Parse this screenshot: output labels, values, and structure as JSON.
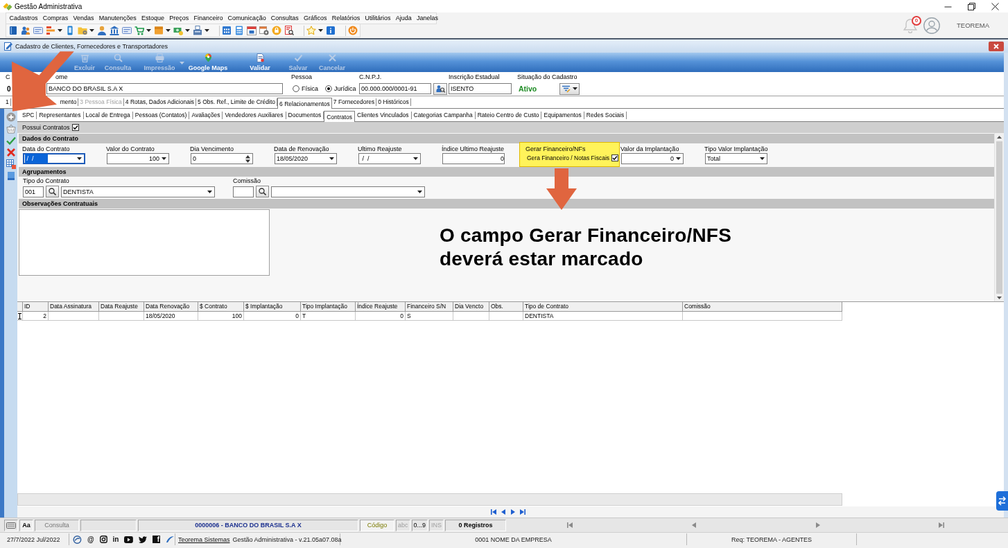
{
  "app": {
    "title": "Gestão Administrativa"
  },
  "menu": [
    "Cadastros",
    "Compras",
    "Vendas",
    "Manutenções",
    "Estoque",
    "Preços",
    "Financeiro",
    "Comunicação",
    "Consultas",
    "Gráficos",
    "Relatórios",
    "Utilitários",
    "Ajuda",
    "Janelas"
  ],
  "toolbar": [
    [
      {
        "kind": "book",
        "dropdown": false
      },
      {
        "kind": "people",
        "dropdown": false
      },
      {
        "kind": "card",
        "dropdown": false
      },
      {
        "kind": "chart",
        "dropdown": true
      },
      {
        "kind": "phone",
        "dropdown": false
      },
      {
        "kind": "folder",
        "dropdown": true
      },
      {
        "kind": "person",
        "dropdown": false
      },
      {
        "kind": "bank",
        "dropdown": false
      },
      {
        "kind": "card",
        "dropdown": false
      },
      {
        "kind": "cart",
        "dropdown": true
      },
      {
        "kind": "package",
        "dropdown": true
      },
      {
        "kind": "money",
        "dropdown": true
      },
      {
        "kind": "register",
        "dropdown": true
      }
    ],
    [
      {
        "kind": "grid-calendar",
        "dropdown": false
      },
      {
        "kind": "calculator",
        "dropdown": false
      },
      {
        "kind": "calendar",
        "dropdown": false
      },
      {
        "kind": "calendar-gear",
        "dropdown": false
      },
      {
        "kind": "lock",
        "dropdown": false
      },
      {
        "kind": "report",
        "dropdown": false
      }
    ],
    [
      {
        "kind": "star",
        "dropdown": true
      },
      {
        "kind": "info",
        "dropdown": false
      }
    ],
    [
      {
        "kind": "power",
        "dropdown": false
      }
    ]
  ],
  "user": {
    "notifications": "0",
    "name": "TEOREMA"
  },
  "form_window": {
    "title": "Cadastro de Clientes, Fornecedores e Transportadores"
  },
  "actions": [
    {
      "kind": "delete",
      "label": "Excluir",
      "disabled": true,
      "dropdown": false
    },
    {
      "kind": "search",
      "label": "Consulta",
      "disabled": true,
      "dropdown": false
    },
    {
      "kind": "print",
      "label": "Impressão",
      "disabled": true,
      "dropdown": true
    },
    {
      "kind": "map",
      "label": "Google Maps",
      "disabled": false,
      "dropdown": false
    },
    {
      "kind": "validate",
      "label": "Validar",
      "disabled": false,
      "dropdown": false
    },
    {
      "kind": "save",
      "label": "Salvar",
      "disabled": true,
      "dropdown": false
    },
    {
      "kind": "cancel",
      "label": "Cancelar",
      "disabled": true,
      "dropdown": false
    }
  ],
  "header": {
    "code": {
      "label": "C",
      "value": "0"
    },
    "name": {
      "label": "ome",
      "value": "BANCO DO BRASIL S.A X"
    },
    "person": {
      "label": "Pessoa",
      "options": [
        {
          "label": "Física",
          "selected": false
        },
        {
          "label": "Jurídica",
          "selected": true
        }
      ]
    },
    "cnpj": {
      "label": "C.N.P.J.",
      "value": "00.000.000/0001-91"
    },
    "state_registration": {
      "label": "Inscrição Estadual",
      "value": "ISENTO"
    },
    "status": {
      "label": "Situação do Cadastro",
      "value": "Ativo"
    }
  },
  "main_tabs": [
    {
      "label": "1",
      "selected": false,
      "disabled": false
    },
    {
      "label": "mento",
      "selected": false,
      "disabled": false
    },
    {
      "label": "3 Pessoa Física",
      "selected": false,
      "disabled": true
    },
    {
      "label": "4 Rotas, Dados Adicionais",
      "selected": false,
      "disabled": false
    },
    {
      "label": "5 Obs. Ref., Limite de Crédito",
      "selected": false,
      "disabled": false
    },
    {
      "label": "6 Relacionamentos",
      "selected": true,
      "disabled": false
    },
    {
      "label": "7 Fornecedores",
      "selected": false,
      "disabled": false
    },
    {
      "label": "0 Históricos",
      "selected": false,
      "disabled": false
    }
  ],
  "side_toolbar": [
    {
      "kind": "add"
    },
    {
      "kind": "basket"
    },
    {
      "kind": "confirm"
    },
    {
      "kind": "discard"
    },
    {
      "kind": "grid"
    },
    {
      "kind": "note"
    }
  ],
  "sub_tabs": [
    {
      "label": "SPC",
      "selected": false
    },
    {
      "label": "Representantes",
      "selected": false
    },
    {
      "label": "Local de Entrega",
      "selected": false
    },
    {
      "label": "Pessoas (Contatos)",
      "selected": false
    },
    {
      "label": "Avaliações",
      "selected": false
    },
    {
      "label": "Vendedores Auxiliares",
      "selected": false
    },
    {
      "label": "Documentos",
      "selected": false
    },
    {
      "label": "Contratos",
      "selected": true
    },
    {
      "label": "Clientes Vinculados",
      "selected": false
    },
    {
      "label": "Categorias Campanha",
      "selected": false
    },
    {
      "label": "Rateio Centro de Custo",
      "selected": false
    },
    {
      "label": "Equipamentos",
      "selected": false
    },
    {
      "label": "Redes Sociais",
      "selected": false
    }
  ],
  "contracts": {
    "has_contracts": {
      "label": "Possui Contratos",
      "checked": true
    },
    "details": {
      "title": "Dados do Contrato",
      "fields": [
        {
          "kind": "date",
          "label": "Data do Contrato",
          "value": " /  /",
          "focused": true,
          "highlighted": false
        },
        {
          "kind": "calc",
          "label": "Valor do Contrato",
          "value": "100",
          "focused": false,
          "highlighted": false
        },
        {
          "kind": "spin",
          "label": "Dia Vencimento",
          "value": "0",
          "focused": false,
          "highlighted": false
        },
        {
          "kind": "date",
          "label": "Data de Renovação",
          "value": "18/05/2020",
          "focused": false,
          "highlighted": false
        },
        {
          "kind": "date",
          "label": "Ultimo Reajuste",
          "value": " /  /",
          "focused": false,
          "highlighted": false
        },
        {
          "kind": "number",
          "label": "Índice Ultimo Reajuste",
          "value": "0",
          "focused": false,
          "highlighted": false
        },
        {
          "kind": "check",
          "label": "Gerar Financeiro/NFs",
          "check_label": "Gera Financeiro / Notas Fiscais",
          "checked": true,
          "focused": false,
          "highlighted": true
        },
        {
          "kind": "calc",
          "label": "Valor da Implantação",
          "value": "0",
          "focused": false,
          "highlighted": false
        },
        {
          "kind": "combo",
          "label": "Tipo Valor Implantação",
          "value": "Total",
          "focused": false,
          "highlighted": false
        }
      ]
    },
    "grouping": {
      "title": "Agrupamentos",
      "fields": [
        {
          "label": "Tipo do Contrato",
          "code": "001",
          "value": "DENTISTA"
        },
        {
          "label": "Comissão"
        }
      ]
    },
    "notes": {
      "title": "Observações Contratuais"
    }
  },
  "annotation": {
    "text": "O campo Gerar Financeiro/NFS deverá estar marcado"
  },
  "table": {
    "columns": [
      "ID",
      "Data Assinatura",
      "Data Reajuste",
      "Data Renovação",
      "$ Contrato",
      "$ Implantação",
      "Tipo Implantação",
      "Índice Reajuste",
      "Financeiro S/N",
      "Dia Vencto",
      "Obs.",
      "Tipo de Contrato",
      "Comissão"
    ],
    "rows": [
      {
        "editing": true,
        "cells": [
          "2",
          null,
          null,
          "18/05/2020",
          "100",
          "0",
          "T",
          "0",
          "S",
          null,
          null,
          "DENTISTA",
          null
        ]
      }
    ]
  },
  "status_bar": {
    "mode": "Aa",
    "view": "Consulta",
    "record": "0000006 - BANCO DO BRASIL S.A X",
    "key_field": "Código",
    "indicators": [
      {
        "label": "abc",
        "on": false
      },
      {
        "label": "0...9",
        "on": true
      },
      {
        "label": "INS",
        "on": false
      }
    ],
    "records": "0 Registros"
  },
  "footer": {
    "date": "27/7/2022 Jul/2022",
    "social": [
      {
        "kind": "logo"
      },
      {
        "kind": "email",
        "text": "@"
      },
      {
        "kind": "instagram"
      },
      {
        "kind": "linkedin",
        "text": "in"
      },
      {
        "kind": "youtube"
      },
      {
        "kind": "twitter"
      },
      {
        "kind": "facebook",
        "text": "f"
      },
      {
        "kind": "swoosh"
      }
    ],
    "link": "Teorema Sistemas",
    "version": "Gestão Administrativa - v.21.05a07.08a",
    "company": "0001 NOME DA EMPRESA",
    "requester": "Req: TEOREMA - AGENTES"
  }
}
